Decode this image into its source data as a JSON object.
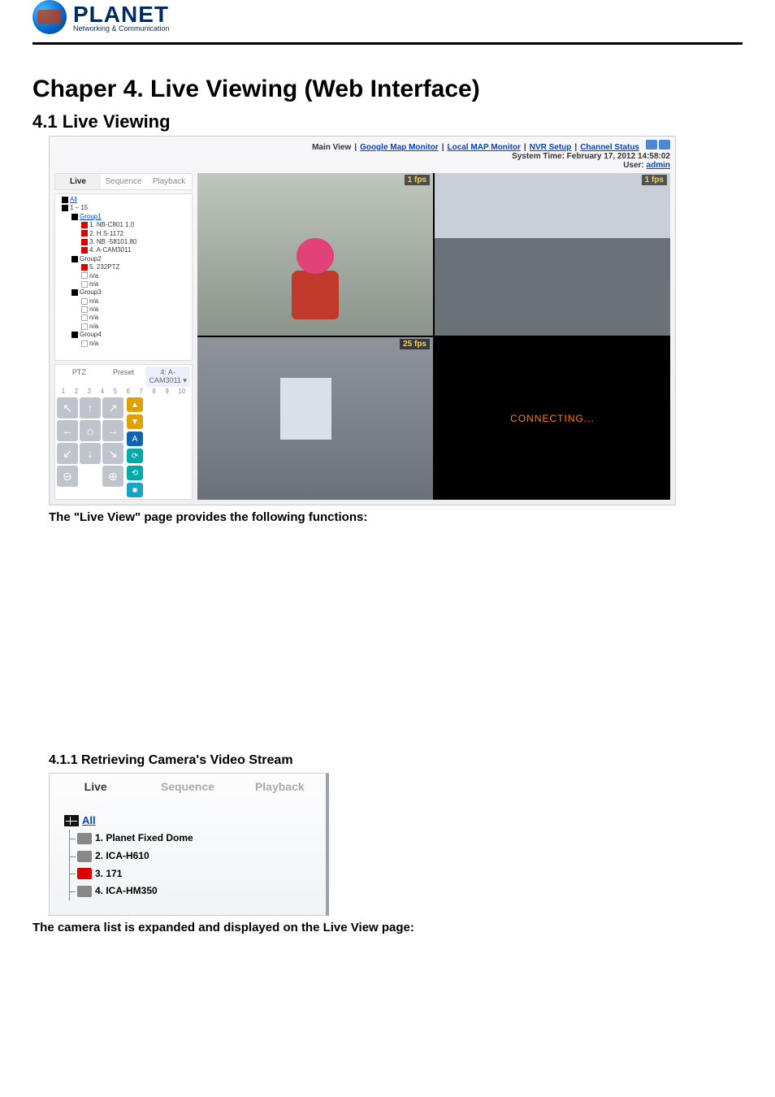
{
  "logo": {
    "brand": "PLANET",
    "tagline": "Networking & Communication"
  },
  "headings": {
    "chapter": "Chaper 4. Live Viewing (Web Interface)",
    "section_4_1": "4.1 Live Viewing",
    "section_4_1_1": "4.1.1 Retrieving Camera's Video Stream"
  },
  "body": {
    "after_ss1": "The \"Live View\" page provides the following functions:",
    "after_ss2": "The camera list is expanded and displayed on the Live View page:"
  },
  "ss1": {
    "nav": {
      "main_view": "Main View",
      "google_map_monitor": "Google Map Monitor",
      "local_map_monitor": "Local MAP Monitor",
      "nvr_setup": "NVR Setup",
      "channel_status": "Channel Status"
    },
    "system_time": "System Time: February 17, 2012 14:58:02",
    "user_label": "User:",
    "user_name": "admin",
    "tabs": {
      "live": "Live",
      "sequence": "Sequence",
      "playback": "Playback"
    },
    "tree": {
      "root": "All",
      "group1_15": "1 – 15",
      "group1_label": "Group1",
      "cam1": "1. NB-C801 1.0",
      "cam2": "2. H.S-1172",
      "cam3": "3. NB -58101.80",
      "cam4": "4. A-CAM3011",
      "group2_label": "Group2",
      "g2a": "5. 232PTZ",
      "g2b": "n/a",
      "g2c": "n/a",
      "group3_label": "Group3",
      "g3a": "n/a",
      "g3b": "n/a",
      "g3c": "n/a",
      "g3d": "n/a",
      "group4_label": "Group4",
      "g4a": "n/a"
    },
    "ptz": {
      "ptz_label": "PTZ",
      "preset_label": "Preset",
      "sel_label": "4: A-CAM3011 ▾",
      "nums": [
        "1",
        "2",
        "3",
        "4",
        "5",
        "6",
        "7",
        "8",
        "9",
        "10"
      ]
    },
    "tiles": {
      "fps_1": "1 fps",
      "fps_2": "1 fps",
      "fps_3": "25 fps",
      "connecting": "CONNECTING..."
    }
  },
  "ss2": {
    "tabs": {
      "live": "Live",
      "sequence": "Sequence",
      "playback": "Playback"
    },
    "tree": {
      "root": "All",
      "item1": "1. Planet Fixed Dome",
      "item2": "2. ICA-H610",
      "item3": "3. 171",
      "item4": "4. ICA-HM350"
    }
  }
}
